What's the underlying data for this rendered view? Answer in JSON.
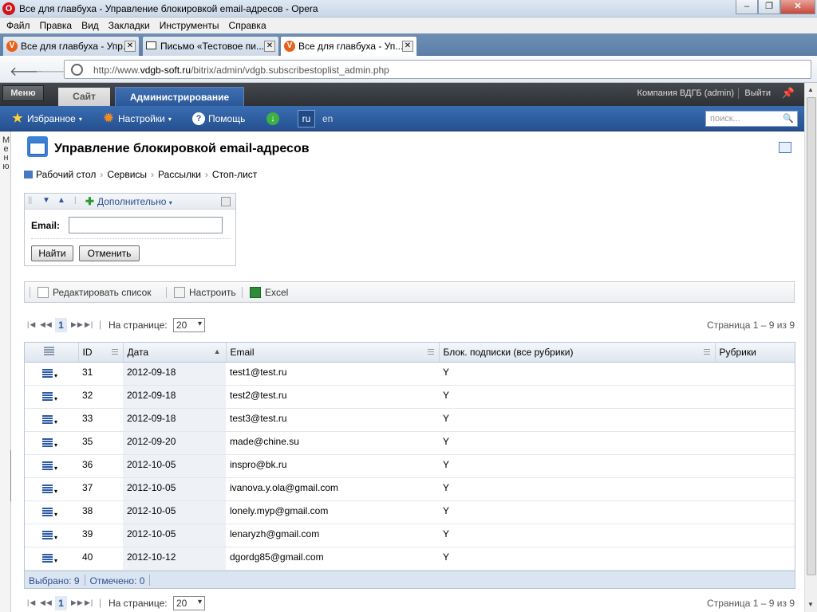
{
  "window": {
    "title": "Все для главбуха - Управление блокировкой email-адресов - Opera"
  },
  "menu": [
    "Файл",
    "Правка",
    "Вид",
    "Закладки",
    "Инструменты",
    "Справка"
  ],
  "tabs": [
    {
      "label": "Все для главбуха - Упр..."
    },
    {
      "label": "Письмо «Тестовое пи..."
    },
    {
      "label": "Все для главбуха - Уп..."
    }
  ],
  "address": {
    "prefix": "http://www.",
    "host": "vdgb-soft.ru",
    "path": "/bitrix/admin/vdgb.subscribestoplist_admin.php"
  },
  "bx": {
    "menu_label": "Меню",
    "site_tab": "Сайт",
    "admin_tab": "Администрирование",
    "user": "Компания ВДГБ (admin)",
    "logout": "Выйти",
    "favorites": "Избранное",
    "settings": "Настройки",
    "help": "Помощь",
    "lang_ru": "ru",
    "lang_en": "en",
    "search_placeholder": "поиск..."
  },
  "sidebar_label": "Меню",
  "page": {
    "title": "Управление блокировкой email-адресов",
    "breadcrumbs": [
      "Рабочий стол",
      "Сервисы",
      "Рассылки",
      "Стоп-лист"
    ]
  },
  "filter": {
    "more": "Дополнительно",
    "email_label": "Email:",
    "email_value": "",
    "find": "Найти",
    "cancel": "Отменить"
  },
  "toolbar": {
    "edit": "Редактировать список",
    "configure": "Настроить",
    "excel": "Excel"
  },
  "pager": {
    "current": "1",
    "per_page_label": "На странице:",
    "per_page": "20",
    "page_of": "Страница 1 – 9 из 9"
  },
  "table": {
    "headers": [
      "ID",
      "Дата",
      "Email",
      "Блок. подписки (все рубрики)",
      "Рубрики"
    ],
    "rows": [
      [
        "31",
        "2012-09-18",
        "test1@test.ru",
        "Y",
        ""
      ],
      [
        "32",
        "2012-09-18",
        "test2@test.ru",
        "Y",
        ""
      ],
      [
        "33",
        "2012-09-18",
        "test3@test.ru",
        "Y",
        ""
      ],
      [
        "35",
        "2012-09-20",
        "made@chine.su",
        "Y",
        ""
      ],
      [
        "36",
        "2012-10-05",
        "inspro@bk.ru",
        "Y",
        ""
      ],
      [
        "37",
        "2012-10-05",
        "ivanova.y.ola@gmail.com",
        "Y",
        ""
      ],
      [
        "38",
        "2012-10-05",
        "lonely.myp@gmail.com",
        "Y",
        ""
      ],
      [
        "39",
        "2012-10-05",
        "lenaryzh@gmail.com",
        "Y",
        ""
      ],
      [
        "40",
        "2012-10-12",
        "dgordg85@gmail.com",
        "Y",
        ""
      ]
    ],
    "footer": {
      "selected": "Выбрано: 9",
      "checked": "Отмечено: 0"
    }
  }
}
